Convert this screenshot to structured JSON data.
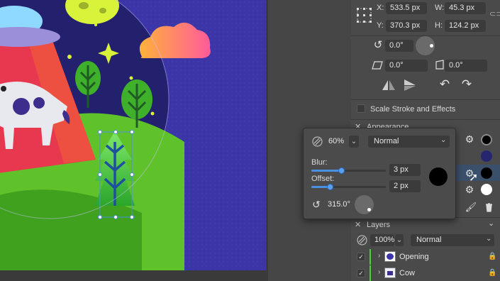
{
  "transform": {
    "x_label": "X:",
    "x_value": "533.5 px",
    "w_label": "W:",
    "w_value": "45.3 px",
    "y_label": "Y:",
    "y_value": "370.3 px",
    "h_label": "H:",
    "h_value": "124.2 px",
    "rotation_value": "0.0°",
    "shear_value": "0.0°",
    "skew_value": "0.0°"
  },
  "scale_stroke_label": "Scale Stroke and Effects",
  "appearance": {
    "title": "Appearance"
  },
  "shadow_popup": {
    "opacity_value": "60%",
    "blend_mode": "Normal",
    "blur_label": "Blur:",
    "blur_value": "3 px",
    "blur_level": 0.4,
    "offset_label": "Offset:",
    "offset_value": "2 px",
    "offset_level": 0.25,
    "angle_value": "315.0°",
    "color": "#000000"
  },
  "layers": {
    "title": "Layers",
    "opacity_value": "100%",
    "blend_mode": "Normal",
    "items": [
      {
        "name": "Opening"
      },
      {
        "name": "Cow"
      }
    ]
  },
  "colors": {
    "artboard": "#3b35a8",
    "panel": "#4a4a4a",
    "accent": "#4a90e2",
    "layer_bar": "#4cd137"
  }
}
